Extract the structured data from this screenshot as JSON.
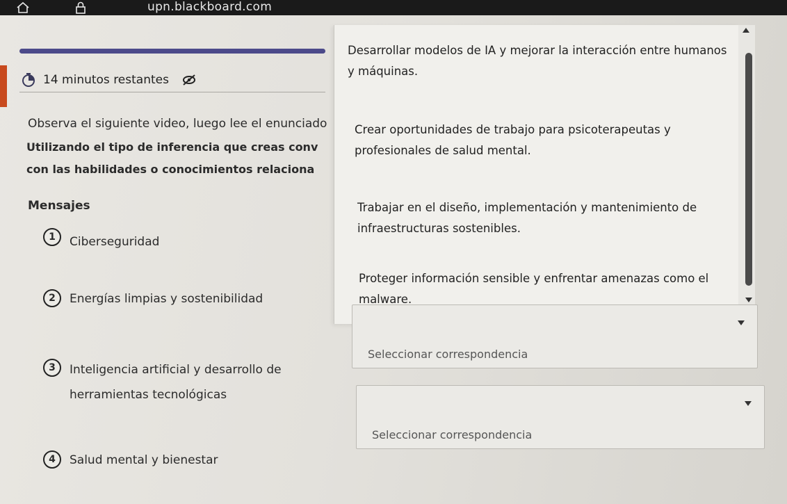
{
  "browser": {
    "url": "upn.blackboard.com"
  },
  "quiz": {
    "timer_text": "14 minutos restantes",
    "progress": 1.0,
    "instructions": [
      "Observa el siguiente video, luego lee el enunciado",
      "Utilizando el tipo de inferencia que creas conv",
      "con las habilidades o conocimientos relaciona"
    ]
  },
  "messages": {
    "title": "Mensajes",
    "items": [
      {
        "number": "1",
        "label": "Ciberseguridad"
      },
      {
        "number": "2",
        "label": "Energías limpias y sostenibilidad"
      },
      {
        "number": "3",
        "label": "Inteligencia artificial y desarrollo de herramientas tecnológicas"
      },
      {
        "number": "4",
        "label": "Salud mental y bienestar"
      }
    ]
  },
  "options": [
    {
      "text": "Desarrollar modelos de IA y mejorar la interacción entre humanos y máquinas."
    },
    {
      "text": "Crear oportunidades de trabajo para psicoterapeutas y profesionales de salud mental."
    },
    {
      "text": "Trabajar en el diseño, implementación y mantenimiento de infraestructuras sostenibles."
    },
    {
      "text": "Proteger información sensible y enfrentar amenazas como el malware."
    }
  ],
  "selects": [
    {
      "placeholder": "Seleccionar correspondencia"
    },
    {
      "placeholder": "Seleccionar correspondencia"
    }
  ],
  "colors": {
    "accent": "#4c4a8a",
    "alert": "#c84a1e"
  }
}
